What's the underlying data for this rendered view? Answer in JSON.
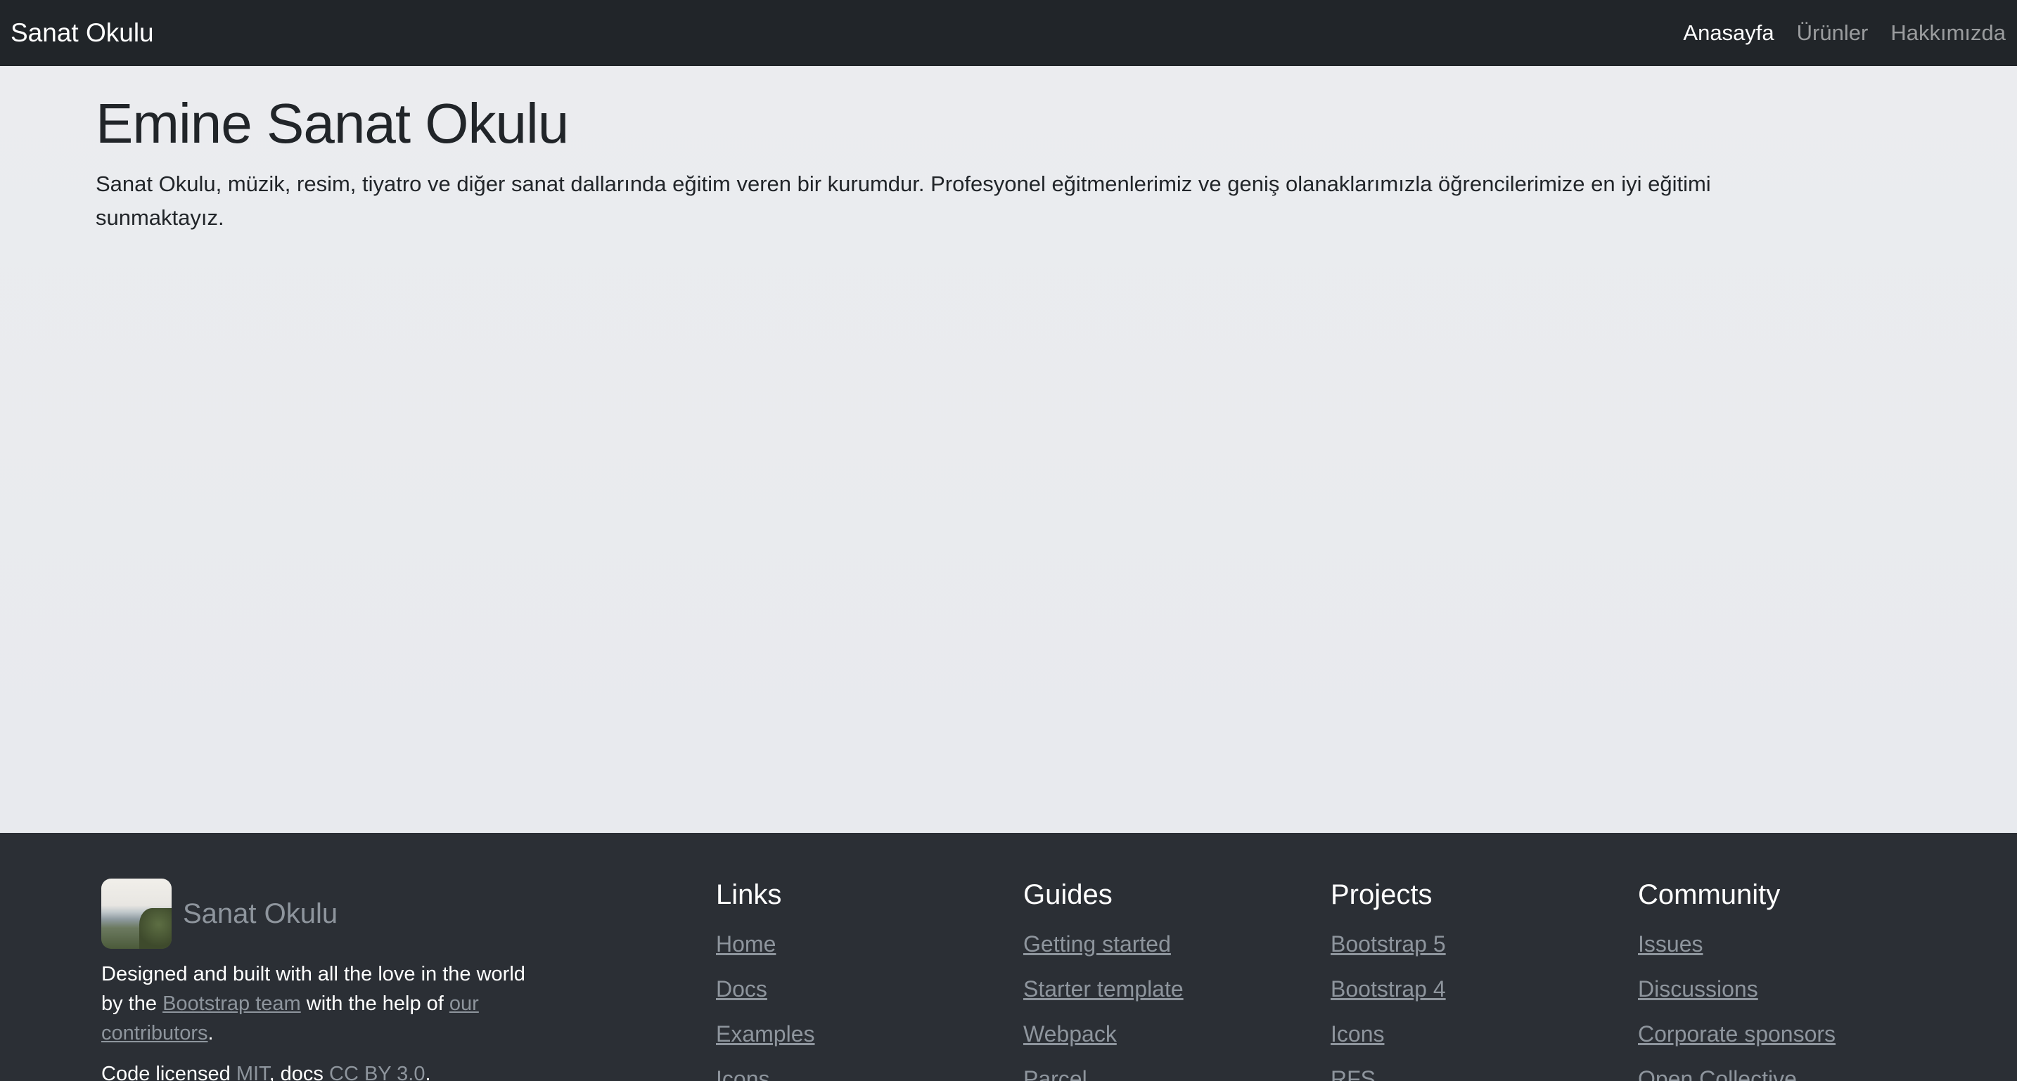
{
  "navbar": {
    "brand": "Sanat Okulu",
    "items": [
      {
        "label": "Anasayfa",
        "active": true
      },
      {
        "label": "Ürünler",
        "active": false
      },
      {
        "label": "Hakkımızda",
        "active": false
      }
    ]
  },
  "hero": {
    "title": "Emine Sanat Okulu",
    "text": "Sanat Okulu, müzik, resim, tiyatro ve diğer sanat dallarında eğitim veren bir kurumdur. Profesyonel eğitmenlerimiz ve geniş olanaklarımızla öğrencilerimize en iyi eğitimi sunmaktayız."
  },
  "footer": {
    "logo_name": "Sanat Okulu",
    "about": {
      "part1": "Designed and built with all the love in the world by the ",
      "link1": "Bootstrap team",
      "part2": " with the help of ",
      "link2": "our contributors",
      "part3": "."
    },
    "license": {
      "part1": "Code licensed ",
      "link1": "MIT",
      "part2": ", docs ",
      "link2": "CC BY 3.0",
      "part3": "."
    },
    "columns": [
      {
        "heading": "Links",
        "items": [
          "Home",
          "Docs",
          "Examples",
          "Icons"
        ]
      },
      {
        "heading": "Guides",
        "items": [
          "Getting started",
          "Starter template",
          "Webpack",
          "Parcel"
        ]
      },
      {
        "heading": "Projects",
        "items": [
          "Bootstrap 5",
          "Bootstrap 4",
          "Icons",
          "RFS"
        ]
      },
      {
        "heading": "Community",
        "items": [
          "Issues",
          "Discussions",
          "Corporate sponsors",
          "Open Collective"
        ]
      }
    ]
  }
}
